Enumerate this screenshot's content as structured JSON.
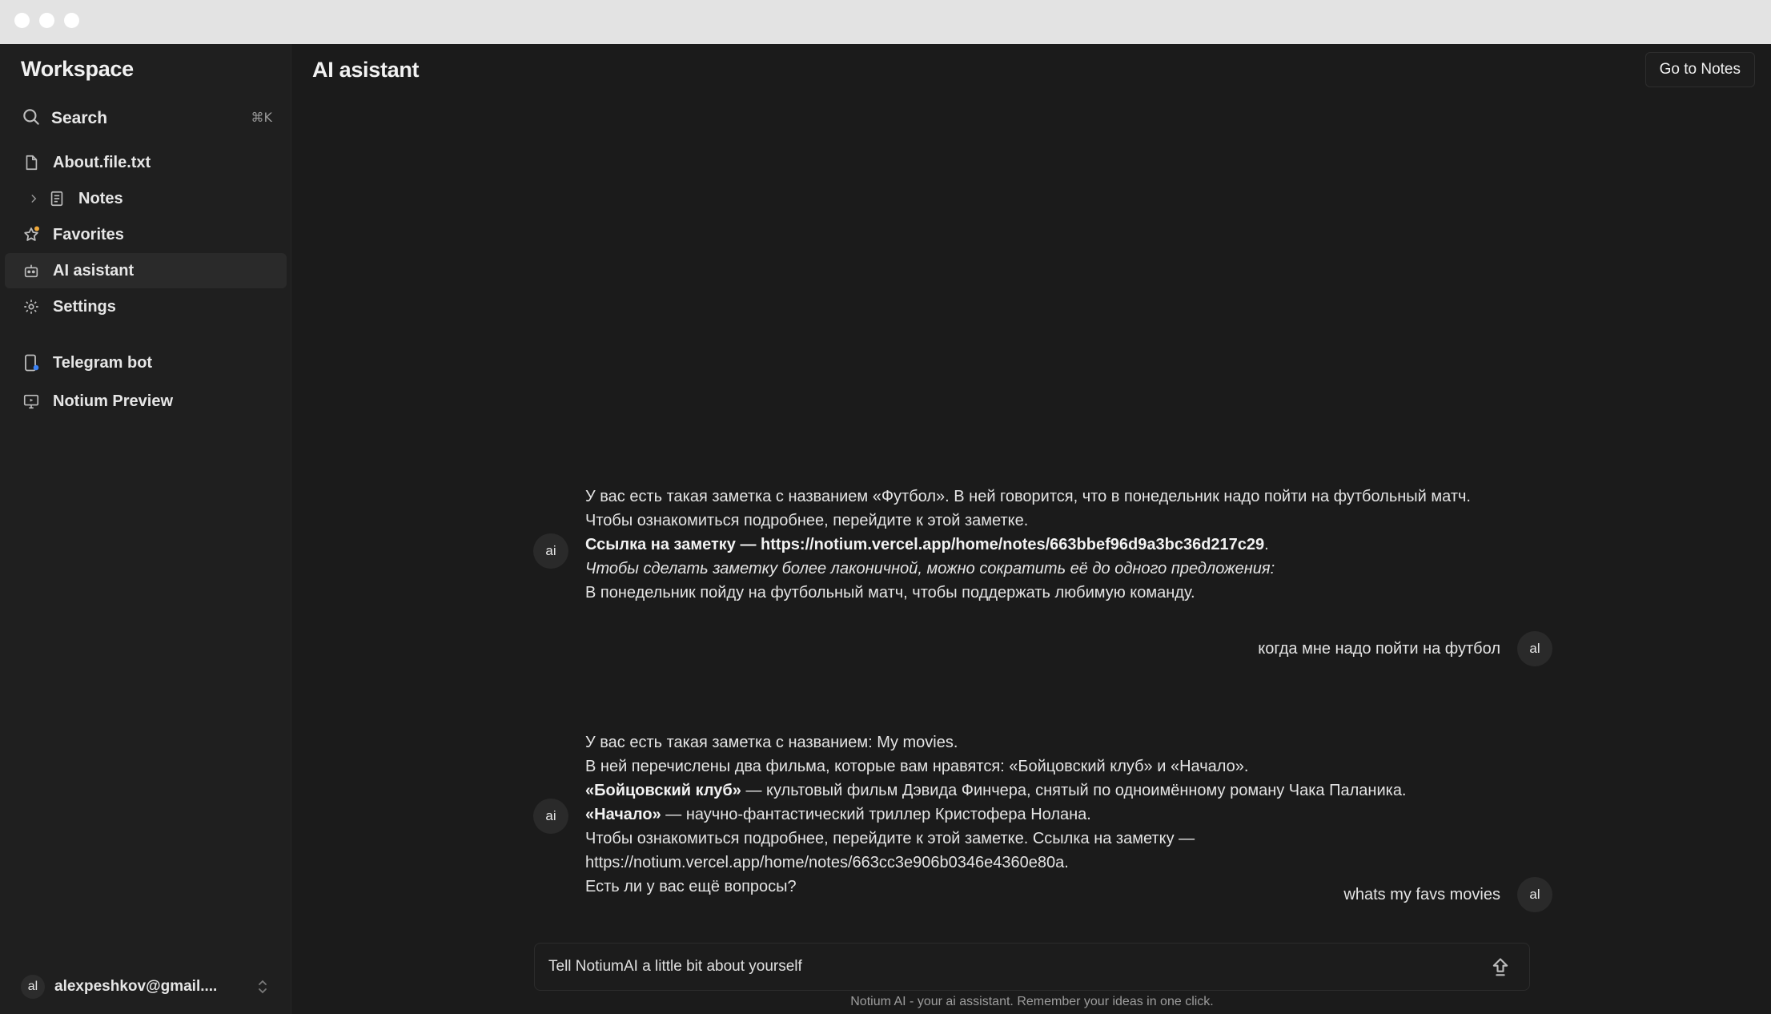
{
  "window": {
    "controls": [
      "close",
      "minimize",
      "maximize"
    ]
  },
  "sidebar": {
    "title": "Workspace",
    "search": {
      "label": "Search",
      "shortcut": "⌘K"
    },
    "items": [
      {
        "label": "About.file.txt",
        "icon": "file-icon"
      },
      {
        "label": "Notes",
        "icon": "notes-icon",
        "expandable": true
      },
      {
        "label": "Favorites",
        "icon": "star-icon"
      },
      {
        "label": "AI asistant",
        "icon": "robot-icon",
        "active": true
      },
      {
        "label": "Settings",
        "icon": "gear-icon"
      }
    ],
    "extra_items": [
      {
        "label": "Telegram bot",
        "icon": "phone-icon"
      },
      {
        "label": "Notium Preview",
        "icon": "monitor-icon"
      }
    ],
    "user": {
      "initials": "al",
      "email": "alexpeshkov@gmail...."
    }
  },
  "header": {
    "title": "AI asistant",
    "goto_button": "Go to Notes"
  },
  "chat": {
    "messages": [
      {
        "role": "ai",
        "avatar": "ai",
        "lines": [
          "У вас есть такая заметка с названием «Футбол». В ней говорится, что в понедельник надо пойти на футбольный матч.",
          "Чтобы ознакомиться подробнее, перейдите к этой заметке.",
          "Ссылка на заметку — https://notium.vercel.app/home/notes/663bbef96d9a3bc36d217c29",
          "Чтобы сделать заметку более лаконичной, можно сократить её до одного предложения:",
          "В понедельник пойду на футбольный матч, чтобы поддержать любимую команду."
        ]
      },
      {
        "role": "user",
        "avatar": "al",
        "text": "когда мне надо пойти на футбол"
      },
      {
        "role": "ai",
        "avatar": "ai",
        "lines": [
          "У вас есть такая заметка с названием: My movies.",
          "В ней перечислены два фильма, которые вам нравятся: «Бойцовский клуб» и «Начало».",
          "«Бойцовский клуб»",
          " — культовый фильм Дэвида Финчера, снятый по одноимённому роману Чака Паланика.",
          "«Начало»",
          " — научно-фантастический триллер Кристофера Нолана.",
          "Чтобы ознакомиться подробнее, перейдите к этой заметке. Ссылка на заметку —",
          "https://notium.vercel.app/home/notes/663cc3e906b0346e4360e80a.",
          "Есть ли у вас ещё вопросы?"
        ]
      },
      {
        "role": "user",
        "avatar": "al",
        "text": "whats my favs movies"
      }
    ],
    "input": {
      "placeholder": "Tell NotiumAI a little bit about yourself"
    },
    "footnote": "Notium AI - your ai assistant. Remember your ideas in one click."
  }
}
